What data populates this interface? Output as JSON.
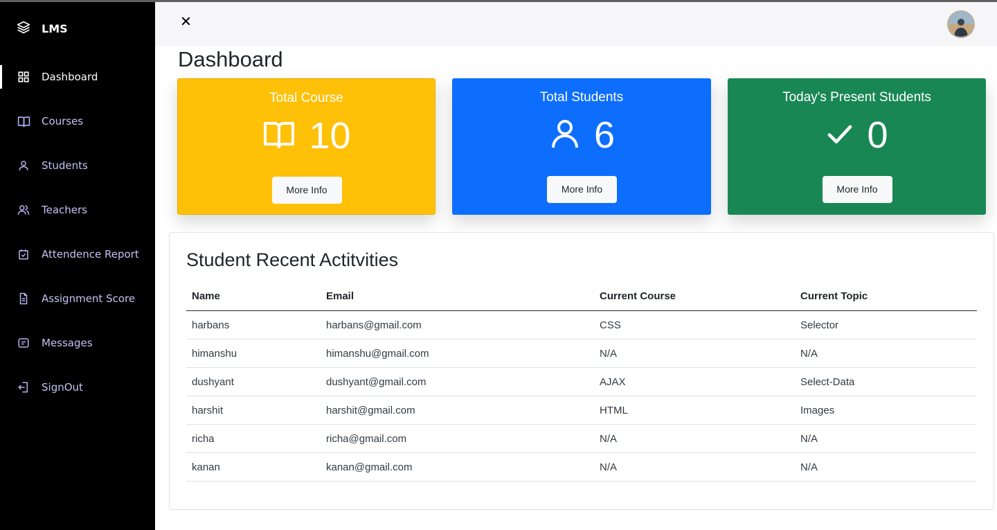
{
  "app": {
    "brand": "LMS"
  },
  "sidebar": {
    "items": [
      {
        "label": "Dashboard",
        "icon": "grid-icon",
        "active": true
      },
      {
        "label": "Courses",
        "icon": "book-icon"
      },
      {
        "label": "Students",
        "icon": "user-icon"
      },
      {
        "label": "Teachers",
        "icon": "users-icon"
      },
      {
        "label": "Attendence Report",
        "icon": "calendar-check-icon"
      },
      {
        "label": "Assignment Score",
        "icon": "document-icon"
      },
      {
        "label": "Messages",
        "icon": "message-icon"
      },
      {
        "label": "SignOut",
        "icon": "signout-icon"
      }
    ]
  },
  "header": {
    "close_icon": "close-icon",
    "avatar": "avatar"
  },
  "page": {
    "title": "Dashboard"
  },
  "cards": [
    {
      "title": "Total Course",
      "value": "10",
      "icon": "book-icon",
      "button": "More Info",
      "color": "#ffc107"
    },
    {
      "title": "Total Students",
      "value": "6",
      "icon": "user-icon",
      "button": "More Info",
      "color": "#0d6efd"
    },
    {
      "title": "Today's Present Students",
      "value": "0",
      "icon": "check-icon",
      "button": "More Info",
      "color": "#198754"
    }
  ],
  "activities": {
    "title": "Student Recent Actitvities",
    "columns": [
      "Name",
      "Email",
      "Current Course",
      "Current Topic"
    ],
    "rows": [
      [
        "harbans",
        "harbans@gmail.com",
        "CSS",
        "Selector"
      ],
      [
        "himanshu",
        "himanshu@gmail.com",
        "N/A",
        "N/A"
      ],
      [
        "dushyant",
        "dushyant@gmail.com",
        "AJAX",
        "Select-Data"
      ],
      [
        "harshit",
        "harshit@gmail.com",
        "HTML",
        "Images"
      ],
      [
        "richa",
        "richa@gmail.com",
        "N/A",
        "N/A"
      ],
      [
        "kanan",
        "kanan@gmail.com",
        "N/A",
        "N/A"
      ]
    ]
  }
}
